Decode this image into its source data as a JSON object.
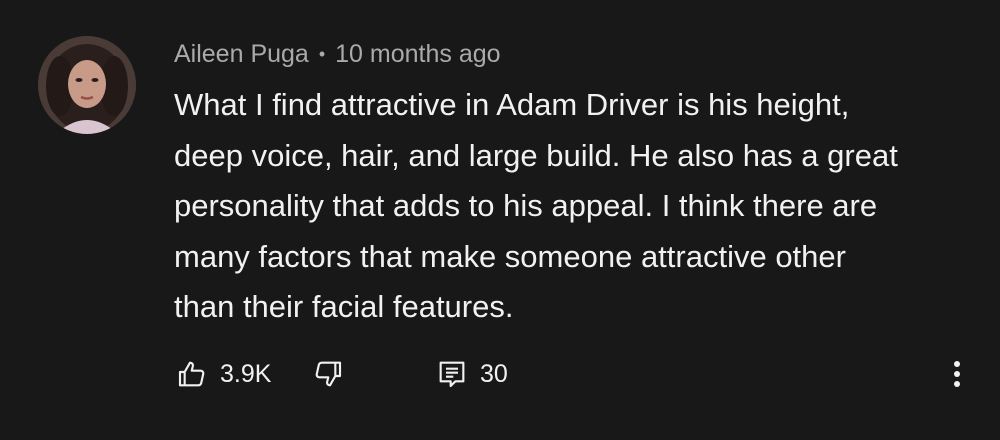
{
  "comment": {
    "author": "Aileen Puga",
    "separator": "•",
    "timestamp": "10 months ago",
    "text_lines": [
      "What I find attractive in Adam Driver is his height,",
      "deep voice, hair, and large build. He also has a great",
      "personality that adds to his appeal. I think there are",
      "many factors that make someone attractive other",
      "than their facial features."
    ],
    "like_count": "3.9K",
    "reply_count": "30"
  },
  "icons": {
    "like": "thumbs-up-icon",
    "dislike": "thumbs-down-icon",
    "replies": "comment-icon",
    "more": "more-vert-icon"
  },
  "colors": {
    "background": "#181818",
    "primary_text": "#f1f1f1",
    "secondary_text": "#aaaaaa"
  }
}
